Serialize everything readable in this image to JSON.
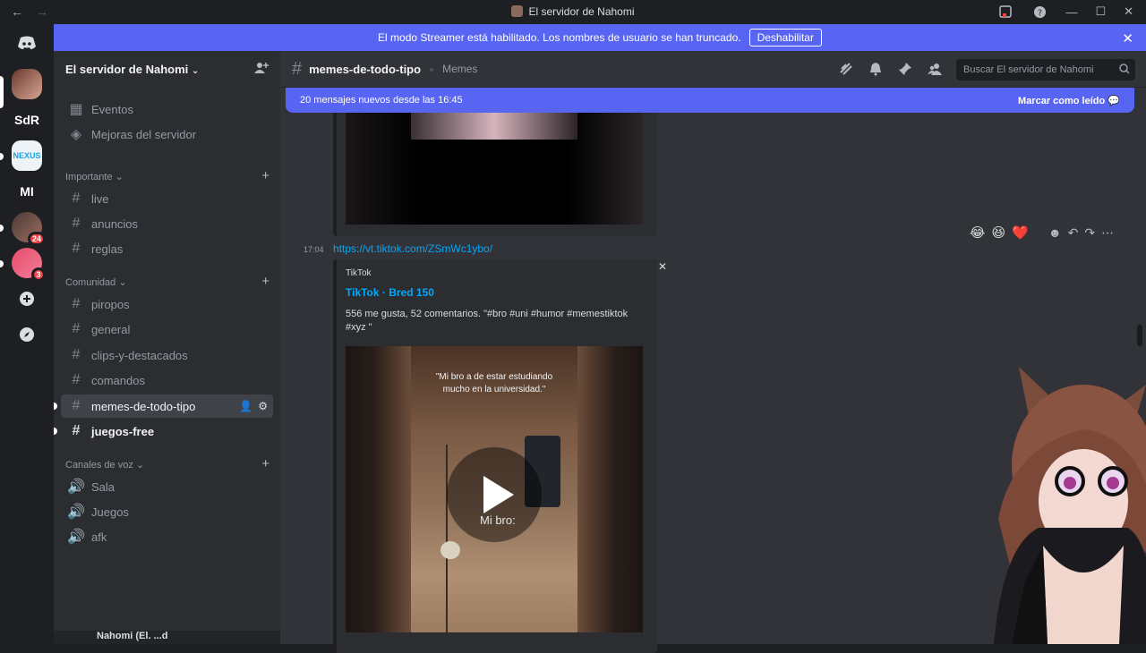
{
  "window": {
    "title": "El servidor de Nahomi",
    "nav": {
      "back": "←",
      "forward": "→"
    }
  },
  "banner": {
    "text": "El modo Streamer está habilitado. Los nombres de usuario se han truncado.",
    "button": "Deshabilitar"
  },
  "guilds": [
    {
      "label": "",
      "kind": "home"
    },
    {
      "label": "",
      "kind": "avatar"
    },
    {
      "label": "SdR"
    },
    {
      "label": "NEXUS"
    },
    {
      "label": "MI"
    },
    {
      "label": "",
      "badge": "24"
    },
    {
      "label": "",
      "badge": "3"
    }
  ],
  "sidebar": {
    "server_name": "El servidor de Nahomi",
    "top_items": [
      "Eventos",
      "Mejoras del servidor"
    ],
    "categories": [
      {
        "name": "Importante",
        "channels": [
          "live",
          "anuncios",
          "reglas"
        ]
      },
      {
        "name": "Comunidad",
        "channels": [
          "piropos",
          "general",
          "clips-y-destacados",
          "comandos",
          "memes-de-todo-tipo",
          "juegos-free"
        ]
      },
      {
        "name": "Canales de voz",
        "channels": [
          "Sala",
          "Juegos",
          "afk"
        ]
      }
    ],
    "user_partial": "Nahomi (El. ...d"
  },
  "channel": {
    "name": "memes-de-todo-tipo",
    "topic": "Memes",
    "search_placeholder": "Buscar El servidor de Nahomi"
  },
  "new_messages": {
    "text": "20 mensajes nuevos desde las 16:45",
    "mark_read": "Marcar como leído"
  },
  "message": {
    "time": "17:04",
    "link": "https://vt.tiktok.com/ZSmWc1ybo/",
    "embed": {
      "provider": "TikTok",
      "title": "TikTok · Bred 150",
      "description": "556 me gusta, 52 comentarios. \"#bro #uni #humor #memestiktok #xyz \"",
      "video_caption": "\"Mi bro a de estar estudiando mucho en la universidad.\"",
      "video_overlay": "Mi bro:"
    },
    "reactions": [
      "😂",
      "😆",
      "❤️"
    ]
  },
  "colors": {
    "blurple": "#5865f2",
    "link": "#00a8fc",
    "red": "#f23f43"
  }
}
